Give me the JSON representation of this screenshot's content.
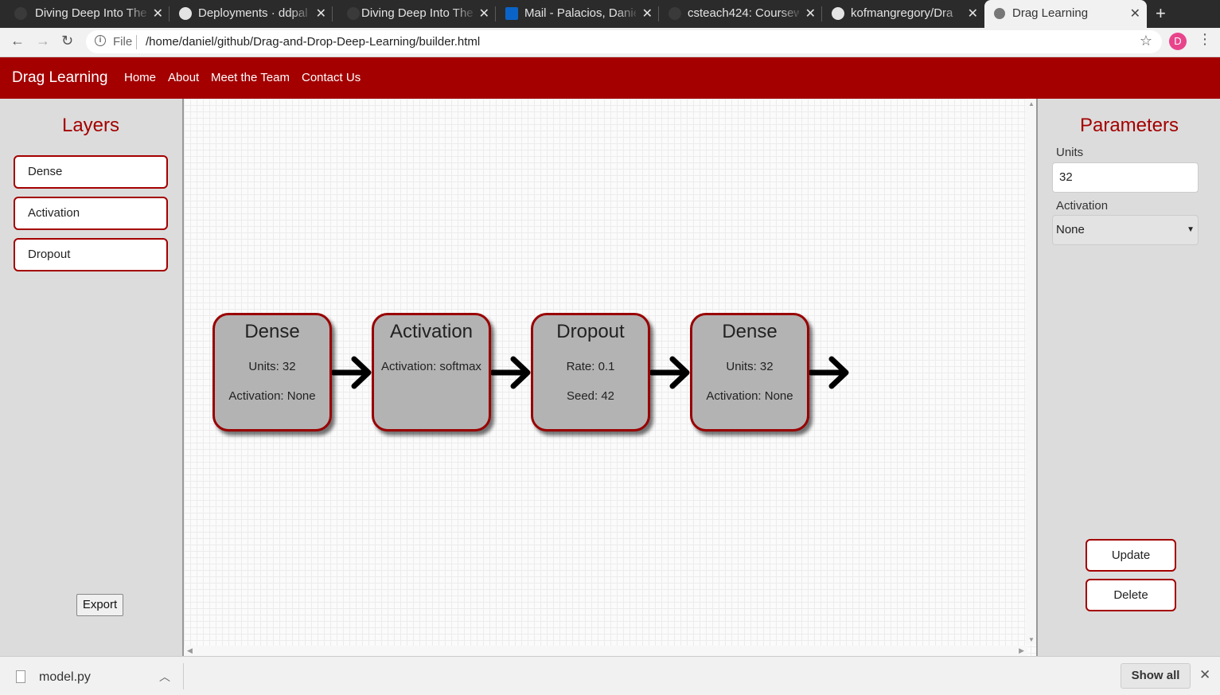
{
  "browser": {
    "tabs": [
      {
        "title": "Diving Deep Into The",
        "favicon_color": "#2b2b2b"
      },
      {
        "title": "Deployments · ddpal",
        "favicon_color": "#e4e4e4"
      },
      {
        "title": "Diving Deep Into The",
        "favicon_color": "#2b2b2b"
      },
      {
        "title": "Mail - Palacios, Danie",
        "favicon_color": "#0a64c8"
      },
      {
        "title": "csteach424: Coursew",
        "favicon_color": "#2b2b2b"
      },
      {
        "title": "kofmangregory/Dra",
        "favicon_color": "#e4e4e4"
      },
      {
        "title": "Drag Learning",
        "favicon_color": "#555555"
      }
    ],
    "new_tab_label": "+",
    "scheme_label": "File",
    "url": "/home/daniel/github/Drag-and-Drop-Deep-Learning/builder.html",
    "profile_initial": "D"
  },
  "navbar": {
    "brand": "Drag Learning",
    "links": [
      "Home",
      "About",
      "Meet the Team",
      "Contact Us"
    ]
  },
  "layers": {
    "title": "Layers",
    "items": [
      "Dense",
      "Activation",
      "Dropout"
    ],
    "export_label": "Export"
  },
  "model": {
    "nodes": [
      {
        "title": "Dense",
        "lines": [
          "Units: 32",
          "Activation: None"
        ]
      },
      {
        "title": "Activation",
        "lines": [
          "Activation: softmax"
        ]
      },
      {
        "title": "Dropout",
        "lines": [
          "Rate: 0.1",
          "Seed: 42"
        ]
      },
      {
        "title": "Dense",
        "lines": [
          "Units: 32",
          "Activation: None"
        ]
      }
    ]
  },
  "parameters": {
    "title": "Parameters",
    "units_label": "Units",
    "units_value": "32",
    "activation_label": "Activation",
    "activation_value": "None",
    "update_label": "Update",
    "delete_label": "Delete"
  },
  "downloads": {
    "file_name": "model.py",
    "show_all_label": "Show all"
  },
  "colors": {
    "brand_red": "#a40000",
    "node_fill": "#b3b3b3",
    "node_border": "#990000"
  }
}
